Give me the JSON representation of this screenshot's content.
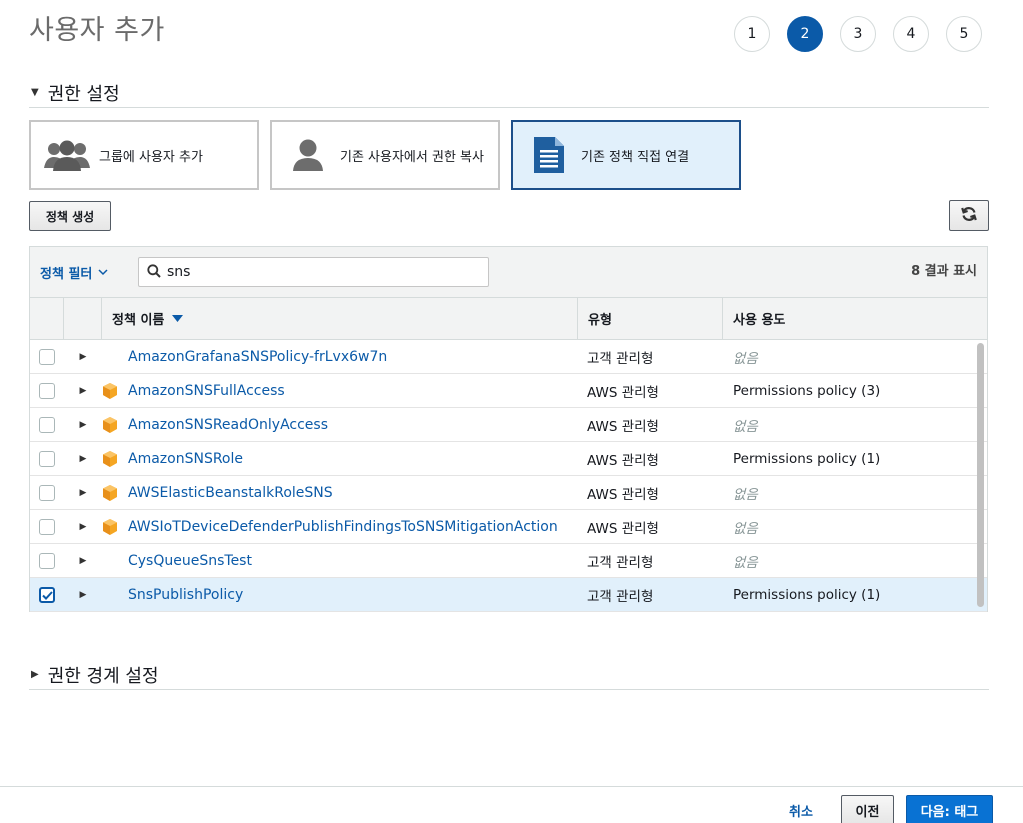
{
  "page": {
    "title": "사용자 추가"
  },
  "steps": [
    "1",
    "2",
    "3",
    "4",
    "5"
  ],
  "active_step": "2",
  "permissions_section": {
    "title": "권한 설정"
  },
  "options": [
    {
      "label": "그룹에 사용자 추가",
      "icon": "group-icon"
    },
    {
      "label": "기존 사용자에서 권한 복사",
      "icon": "user-icon"
    },
    {
      "label": "기존 정책 직접 연결",
      "icon": "document-icon",
      "selected": true
    }
  ],
  "toolbar": {
    "create_policy_label": "정책 생성",
    "refresh_icon": "refresh-icon"
  },
  "filter": {
    "label": "정책 필터",
    "search_value": "sns",
    "result_count": "8 결과 표시"
  },
  "columns": {
    "name": "정책 이름",
    "type": "유형",
    "usage": "사용 용도"
  },
  "rows": [
    {
      "name": "AmazonGrafanaSNSPolicy-frLvx6w7n",
      "type": "고객 관리형",
      "usage": "없음",
      "aws_managed": false,
      "checked": false
    },
    {
      "name": "AmazonSNSFullAccess",
      "type": "AWS 관리형",
      "usage": "Permissions policy (3)",
      "aws_managed": true,
      "checked": false
    },
    {
      "name": "AmazonSNSReadOnlyAccess",
      "type": "AWS 관리형",
      "usage": "없음",
      "aws_managed": true,
      "checked": false
    },
    {
      "name": "AmazonSNSRole",
      "type": "AWS 관리형",
      "usage": "Permissions policy (1)",
      "aws_managed": true,
      "checked": false
    },
    {
      "name": "AWSElasticBeanstalkRoleSNS",
      "type": "AWS 관리형",
      "usage": "없음",
      "aws_managed": true,
      "checked": false
    },
    {
      "name": "AWSIoTDeviceDefenderPublishFindingsToSNSMitigationAction",
      "type": "AWS 관리형",
      "usage": "없음",
      "aws_managed": true,
      "checked": false
    },
    {
      "name": "CysQueueSnsTest",
      "type": "고객 관리형",
      "usage": "없음",
      "aws_managed": false,
      "checked": false
    },
    {
      "name": "SnsPublishPolicy",
      "type": "고객 관리형",
      "usage": "Permissions policy (1)",
      "aws_managed": false,
      "checked": true
    }
  ],
  "boundary_section": {
    "title": "권한 경계 설정"
  },
  "footer": {
    "cancel_label": "취소",
    "prev_label": "이전",
    "next_label": "다음: 태그"
  },
  "colors": {
    "accent": "#0b5aa8",
    "next_button": "#0972d3",
    "selected_bg": "#e1f0fb",
    "aws_icon": "#f5a623"
  }
}
